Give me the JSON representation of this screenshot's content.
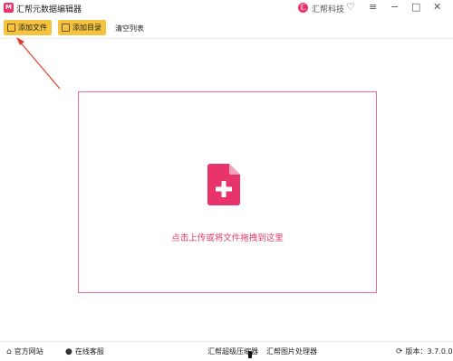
{
  "titlebar": {
    "app_logo": "M",
    "app_title": "汇帮元数据编辑器",
    "brand_logo": "汇",
    "brand_name": "汇帮科技",
    "icons": [
      "heart-icon",
      "menu-icon",
      "minimize-icon",
      "maximize-icon",
      "close-icon"
    ]
  },
  "toolbar": {
    "add_file_label": "添加文件",
    "add_folder_label": "添加目录",
    "clear_list_label": "清空列表"
  },
  "dropzone": {
    "hint": "点击上传或将文件拖拽到这里",
    "accent_color": "#e8336b"
  },
  "footer": {
    "website_label": "官方网站",
    "service_label": "在线客服",
    "compressor_label": "汇帮超级压缩器",
    "image_tool_label": "汇帮图片处理器",
    "version_label": "版本：",
    "version_value": "3.7.0.0"
  },
  "colors": {
    "button_yellow": "#f6c33e",
    "brand_pink": "#e8336b",
    "annotation_red": "#e0402a"
  }
}
